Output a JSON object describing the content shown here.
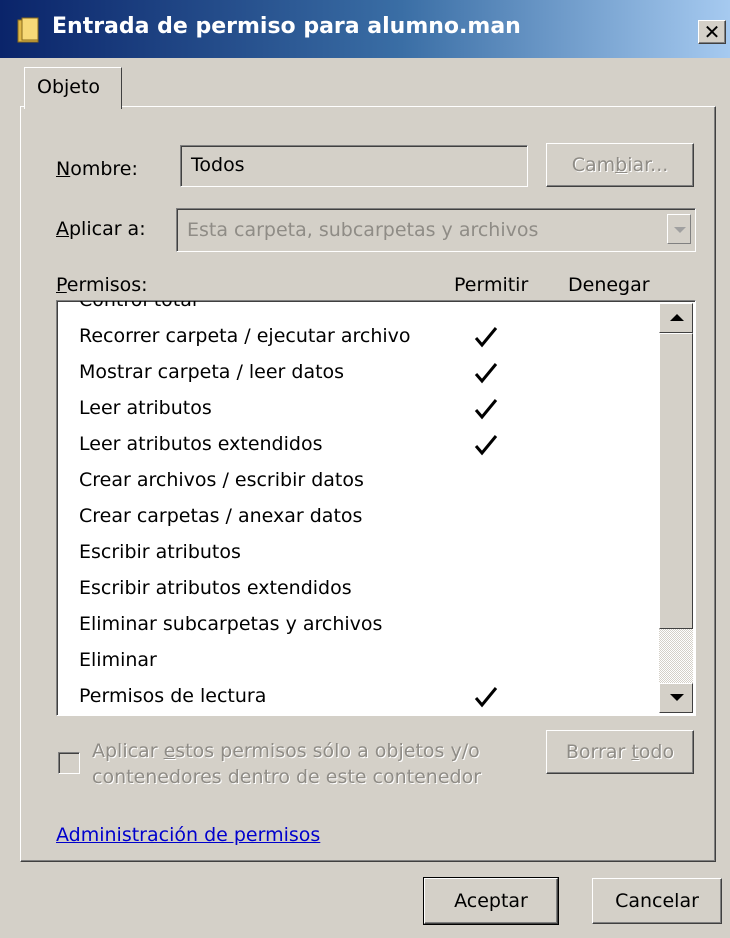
{
  "window": {
    "title": "Entrada de permiso para alumno.man",
    "title_icon": "folder-icon",
    "close_label": "✕",
    "colors": {
      "titlebar_start": "#0a246a",
      "titlebar_end": "#a6caf0",
      "face": "#d4d0c8",
      "link": "#0000cc"
    }
  },
  "tabs": [
    {
      "label": "Objeto"
    }
  ],
  "name_field": {
    "label_key": "N",
    "label_rest": "ombre:",
    "value": "Todos",
    "change_label_pre": "Cam",
    "change_label_key": "b",
    "change_label_post": "iar..."
  },
  "apply_to": {
    "label_key": "A",
    "label_rest": "plicar a:",
    "value": "Esta carpeta, subcarpetas y archivos"
  },
  "permissions": {
    "label_key": "P",
    "label_rest": "ermisos:",
    "col_allow": "Permitir",
    "col_deny": "Denegar",
    "rows": [
      {
        "name": "Control total",
        "allow": false
      },
      {
        "name": "Recorrer carpeta / ejecutar archivo",
        "allow": true
      },
      {
        "name": "Mostrar carpeta / leer datos",
        "allow": true
      },
      {
        "name": "Leer atributos",
        "allow": true
      },
      {
        "name": "Leer atributos extendidos",
        "allow": true
      },
      {
        "name": "Crear archivos / escribir datos",
        "allow": false
      },
      {
        "name": "Crear carpetas / anexar datos",
        "allow": false
      },
      {
        "name": "Escribir atributos",
        "allow": false
      },
      {
        "name": "Escribir atributos extendidos",
        "allow": false
      },
      {
        "name": "Eliminar subcarpetas y archivos",
        "allow": false
      },
      {
        "name": "Eliminar",
        "allow": false
      },
      {
        "name": "Permisos de lectura",
        "allow": true
      }
    ]
  },
  "apply_only_checkbox": {
    "label_pre": "Aplicar ",
    "label_key": "e",
    "label_post": "stos permisos sólo a objetos y/o contenedores dentro de este contenedor",
    "checked": false
  },
  "clear_all": {
    "label_pre": "Borrar ",
    "label_key": "t",
    "label_post": "odo"
  },
  "manage_link": "Administración de permisos",
  "buttons": {
    "ok": "Aceptar",
    "cancel": "Cancelar"
  }
}
